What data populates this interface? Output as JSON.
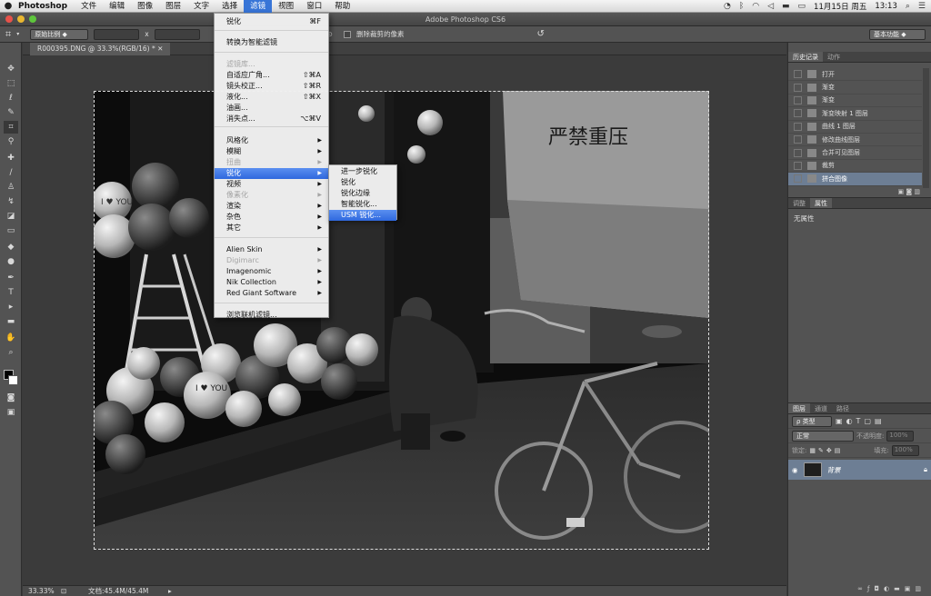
{
  "menubar": {
    "app_name": "Photoshop",
    "items": [
      "文件",
      "编辑",
      "图像",
      "图层",
      "文字",
      "选择",
      "滤镜",
      "视图",
      "窗口",
      "帮助"
    ],
    "date": "11月15日 周五",
    "time": "13:13"
  },
  "window": {
    "title": "Adobe Photoshop CS6"
  },
  "options_bar": {
    "ratio_select": "原始比例",
    "times_symbol": "x",
    "delete_cropped_label": "删除裁剪的像素",
    "workspace": "基本功能"
  },
  "document": {
    "tab_label": "R000395.DNG @ 33.3%(RGB/16) *"
  },
  "status": {
    "zoom": "33.33%",
    "doc_size": "文档:45.4M/45.4M"
  },
  "filter_menu": {
    "items": [
      {
        "label": "锐化",
        "shortcut": "⌘F"
      },
      {
        "label": "转换为智能滤镜"
      },
      {
        "label": "滤镜库...",
        "disabled": true
      },
      {
        "label": "自适应广角...",
        "shortcut": "⇧⌘A"
      },
      {
        "label": "镜头校正...",
        "shortcut": "⇧⌘R"
      },
      {
        "label": "液化...",
        "shortcut": "⇧⌘X"
      },
      {
        "label": "油画..."
      },
      {
        "label": "消失点...",
        "shortcut": "⌥⌘V"
      },
      {
        "label": "风格化"
      },
      {
        "label": "模糊"
      },
      {
        "label": "扭曲",
        "disabled": true
      },
      {
        "label": "锐化",
        "highlighted": true
      },
      {
        "label": "视频"
      },
      {
        "label": "像素化",
        "disabled": true
      },
      {
        "label": "渲染"
      },
      {
        "label": "杂色"
      },
      {
        "label": "其它"
      },
      {
        "label": "Alien Skin"
      },
      {
        "label": "Digimarc",
        "disabled": true
      },
      {
        "label": "Imagenomic"
      },
      {
        "label": "Nik Collection"
      },
      {
        "label": "Red Giant Software"
      },
      {
        "label": "浏览联机滤镜..."
      }
    ]
  },
  "sharpen_submenu": {
    "items": [
      {
        "label": "进一步锐化"
      },
      {
        "label": "锐化"
      },
      {
        "label": "锐化边缘"
      },
      {
        "label": "智能锐化..."
      },
      {
        "label": "USM 锐化...",
        "highlighted": true
      }
    ]
  },
  "history_panel": {
    "tabs": [
      "历史记录",
      "动作"
    ],
    "items": [
      {
        "label": "打开"
      },
      {
        "label": "渐变"
      },
      {
        "label": "渐变"
      },
      {
        "label": "渐变映射 1 图层"
      },
      {
        "label": "曲线 1 图层"
      },
      {
        "label": "修改曲线图层"
      },
      {
        "label": "合并可见图层"
      },
      {
        "label": "裁剪"
      },
      {
        "label": "拼合图像",
        "current": true
      }
    ]
  },
  "properties_panel": {
    "tabs": [
      "调整",
      "属性"
    ],
    "message": "无属性"
  },
  "layers_panel": {
    "tabs": [
      "图层",
      "通道",
      "路径"
    ],
    "filter_kind": "ρ 类型",
    "blend_mode": "正常",
    "opacity_label": "不透明度:",
    "opacity_value": "100%",
    "lock_label": "锁定:",
    "fill_label": "填充:",
    "fill_value": "100%",
    "layer_name": "背景"
  },
  "photo_text": {
    "sign": "严禁重压",
    "balloon_text_1": "I ♥ YOU",
    "balloon_text_2": "I ♥ YOU"
  }
}
